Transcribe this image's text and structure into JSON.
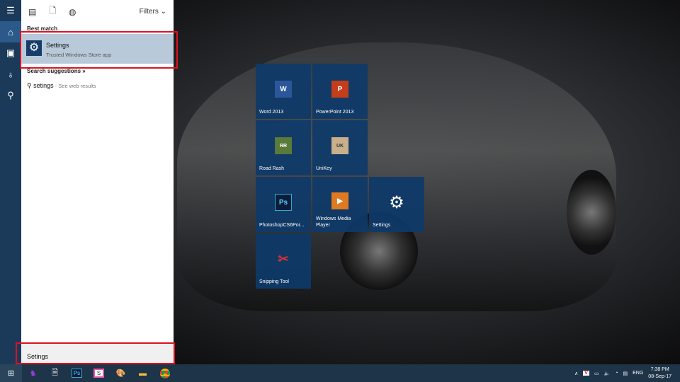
{
  "search_panel": {
    "filters_label": "Filters",
    "best_match_heading": "Best match",
    "best_match": {
      "title": "Settings",
      "subtitle": "Trusted Windows Store app"
    },
    "suggestions_heading": "Search suggestions »",
    "suggestion": {
      "query": "setings",
      "hint": " - See web results"
    },
    "search_value": "Setings"
  },
  "tiles": [
    {
      "label": "Word 2013",
      "icon": "W"
    },
    {
      "label": "PowerPoint 2013",
      "icon": "P"
    },
    {
      "label": "Road Rash",
      "icon": "RR"
    },
    {
      "label": "UniKey",
      "icon": "UK"
    },
    {
      "label": "PhotoshopCS6Por...",
      "icon": "Ps"
    },
    {
      "label": "Windows Media Player",
      "icon": "▶"
    },
    {
      "label": "Settings",
      "icon": "⚙"
    },
    {
      "label": "Snipping Tool",
      "icon": "✂"
    }
  ],
  "taskbar": {
    "language": "ENG",
    "time": "7:38 PM",
    "date": "08-Sep-17",
    "ps_label": "Ps",
    "slack_label": "S"
  }
}
